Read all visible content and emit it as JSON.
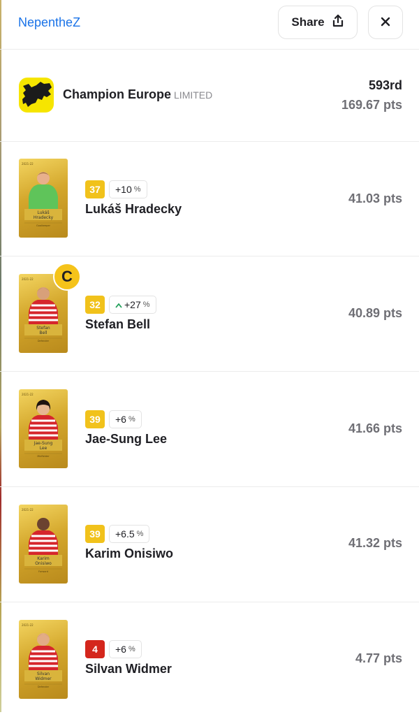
{
  "header": {
    "username": "NepentheZ",
    "share_label": "Share",
    "share_icon": "share-upload-icon",
    "close_icon": "close-icon"
  },
  "competition": {
    "name": "Champion Europe",
    "tag": "LIMITED",
    "rank": "593rd",
    "points": "169.67 pts",
    "logo_icon": "europe-map-logo",
    "logo_color": "#f6e500"
  },
  "players": [
    {
      "name": "Lukáš Hradecky",
      "score": "37",
      "score_color": "#f1c21b",
      "bonus": "+10",
      "bonus_pct": "%",
      "trend_icon": "",
      "points": "41.03 pts",
      "captain": false,
      "card_kit": "goalkeeper-green"
    },
    {
      "name": "Stefan Bell",
      "score": "32",
      "score_color": "#f1c21b",
      "bonus": "+27",
      "bonus_pct": "%",
      "trend_icon": "up-arrow-icon",
      "points": "40.89 pts",
      "captain": true,
      "captain_label": "C",
      "card_kit": "red-white"
    },
    {
      "name": "Jae-Sung Lee",
      "score": "39",
      "score_color": "#f1c21b",
      "bonus": "+6",
      "bonus_pct": "%",
      "trend_icon": "",
      "points": "41.66 pts",
      "captain": false,
      "card_kit": "red-white"
    },
    {
      "name": "Karim Onisiwo",
      "score": "39",
      "score_color": "#f1c21b",
      "bonus": "+6.5",
      "bonus_pct": "%",
      "trend_icon": "",
      "points": "41.32 pts",
      "captain": false,
      "card_kit": "red-white"
    },
    {
      "name": "Silvan Widmer",
      "score": "4",
      "score_color": "#d4261c",
      "bonus": "+6",
      "bonus_pct": "%",
      "trend_icon": "",
      "points": "4.77 pts",
      "captain": false,
      "card_kit": "red-white"
    }
  ]
}
